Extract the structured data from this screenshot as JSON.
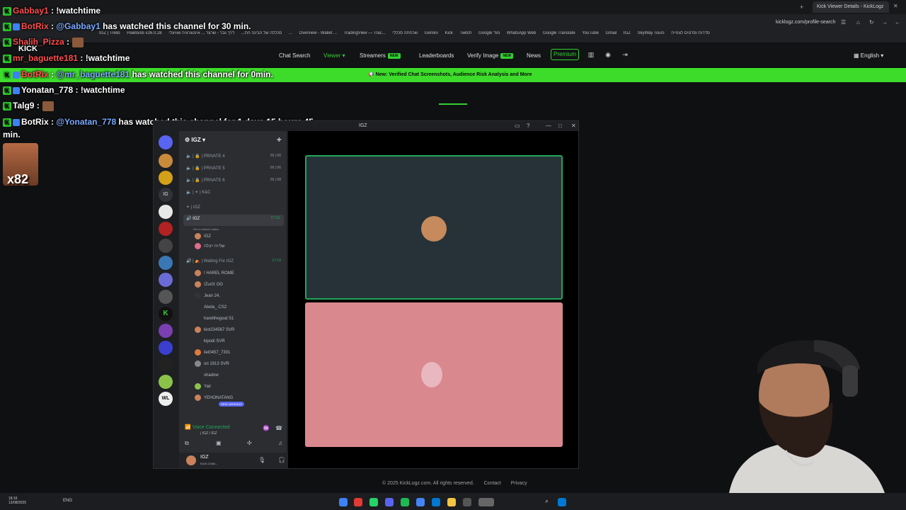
{
  "browser": {
    "tab_title": "Kick Viewer Details - KickLogz",
    "url": "kicklogz.com/profile-search",
    "bookmarks": [
      "IGZ | Trello",
      "Paletools v26.0.28",
      "סכללה של הבינה הת...",
      "דרך גבר - שרצר ...",
      "אינטגרציה שוויצלי ...",
      "Overview - Wallet ...",
      "TradingView — Trac...",
      "שכחתה סכללי",
      "Gemini",
      "Kick",
      "Twitch",
      "Google מוד",
      "WhatsApp Web",
      "Google Translate",
      "YouTube",
      "Gmail",
      "IGZ",
      "SkyWay Tours",
      "סדרות וסרטים לצפייה"
    ]
  },
  "site_nav": {
    "items": [
      {
        "label": "Chat Search"
      },
      {
        "label": "Viewer"
      },
      {
        "label": "Streamers",
        "badge": "NEW"
      },
      {
        "label": "Leaderboards"
      },
      {
        "label": "Verify Image",
        "badge": "NEW"
      },
      {
        "label": "News"
      }
    ],
    "premium": "Premium",
    "language": "English"
  },
  "banner": {
    "text": "New: Verified Chat Screenshots, Audience Risk Analysis and More"
  },
  "footer": {
    "copyright": "© 2025 KickLogz.com. All rights reserved.",
    "contact": "Contact",
    "privacy": "Privacy"
  },
  "chat": [
    {
      "user": "Gabbay1",
      "text": ": !watchtime"
    },
    {
      "user": "BotRix",
      "text": ":",
      "mention": "@Gabbay1",
      "rest": "has watched this channel for 30 min."
    },
    {
      "user": "Shalih_Pizza",
      "text": ":"
    },
    {
      "user": "mr_baguette181",
      "text": ": !watchtime"
    },
    {
      "user": "BotRix",
      "text": ":",
      "mention": "@mr_baguette181",
      "rest": "has watched this channel for 0min."
    },
    {
      "user": "Yonatan_778",
      "text": ": !watchtime"
    },
    {
      "user": "Talg9",
      "text": ":"
    },
    {
      "user": "BotRix",
      "text": ":",
      "mention": "@Yonatan_778",
      "rest": "has watched this channel for 1 days 15 hours 45"
    },
    {
      "text": "min."
    }
  ],
  "emote_label": "x82",
  "kick_overlay": "KICK",
  "discord": {
    "title": "IGZ",
    "server_name": "IGZ",
    "channels": [
      {
        "name": "PRIVATE 4",
        "time": "00 | 06"
      },
      {
        "name": "PRIVATE 5",
        "time": "00 | 06"
      },
      {
        "name": "PRIVATE 6",
        "time": "00 | 08"
      },
      {
        "name": "K&C"
      }
    ],
    "category": "| IGZ",
    "active_channel": {
      "name": "IGZ",
      "time": "17:19",
      "status": "Set a channel status"
    },
    "active_members": [
      "IGZ",
      "שלייח ייבלה"
    ],
    "waiting_channel": {
      "name": "Waiting For IGZ",
      "time": "17:10"
    },
    "waiting_members": [
      {
        "name": "! HAREL",
        "tag": "ROME"
      },
      {
        "name": "!ZuriX",
        "tag": "OG"
      },
      {
        "name": "Jean 24."
      },
      {
        "name": "Abela_",
        "tag": "CS2"
      },
      {
        "name": "harelthegoat",
        "tag": "S1"
      },
      {
        "name": "kiot234567",
        "tag": "SVR"
      },
      {
        "name": "kipodi",
        "tag": "SVR"
      },
      {
        "name": "liel0457_7301"
      },
      {
        "name": "ori 1913",
        "tag": "SVR"
      },
      {
        "name": "shadow"
      },
      {
        "name": "Yair"
      },
      {
        "name": "YEHONATANG"
      }
    ],
    "new_unreads": "NEW UNREADS",
    "voice_connected": "Voice Connected",
    "voice_channel": "| IGZ / IGZ",
    "user_name": "IGZ",
    "user_sub": "KICK.COM/..."
  },
  "taskbar": {
    "time": "18:16",
    "date": "13/08/2025",
    "lang": "ENG"
  },
  "colors": {
    "kick_green": "#3ddc2a",
    "discord_green": "#23a55a",
    "tile_top": "#263238",
    "tile_bottom": "#d9888e"
  }
}
